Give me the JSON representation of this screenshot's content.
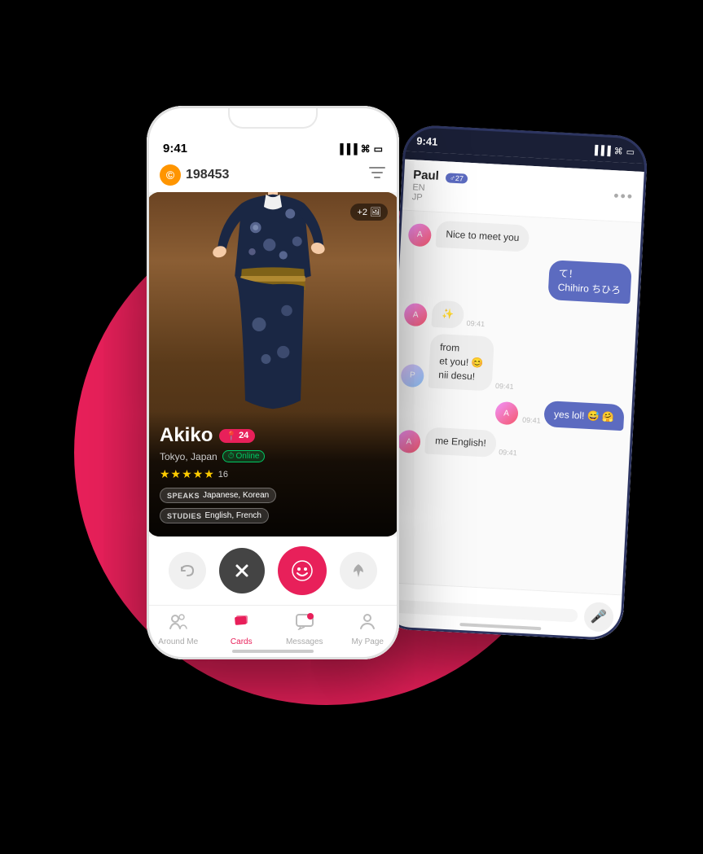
{
  "scene": {
    "background": "#000"
  },
  "phone_front": {
    "status_bar": {
      "time": "9:41",
      "signal": "▐▐▐",
      "wifi": "wifi",
      "battery": "battery"
    },
    "coin_display": {
      "amount": "198453",
      "icon": "©"
    },
    "profile": {
      "name": "Akiko",
      "age": "24",
      "location": "Tokyo, Japan",
      "status": "Online",
      "stars": "★★★★★",
      "review_count": "16",
      "photo_extra": "+2",
      "speaks_label": "SPEAKS",
      "speaks_value": "Japanese, Korean",
      "studies_label": "STUDIES",
      "studies_value": "English, French"
    },
    "action_buttons": {
      "rewind": "↺",
      "nope": "✕",
      "like": "☺",
      "boost": "🚀"
    },
    "bottom_nav": {
      "around_me": "Around Me",
      "cards": "Cards",
      "messages": "Messages",
      "my_page": "My Page"
    }
  },
  "phone_back": {
    "chat_user": {
      "name": "Paul",
      "age": "27",
      "lang1": "EN",
      "lang2": "JP"
    },
    "messages": [
      {
        "type": "received",
        "text": "Nice to meet you",
        "time": null
      },
      {
        "type": "sent",
        "text": "て！\nChihiro ちひろ",
        "time": null
      },
      {
        "type": "received",
        "text": "✨",
        "time": "09:41"
      },
      {
        "type": "received",
        "text": "from\net you! 😊\nnii desu!",
        "time": "09:41"
      },
      {
        "type": "sent",
        "text": "yes lol! 😅 🤗",
        "time": "09:41"
      },
      {
        "type": "received",
        "text": "me English!",
        "time": "09:41"
      }
    ]
  }
}
